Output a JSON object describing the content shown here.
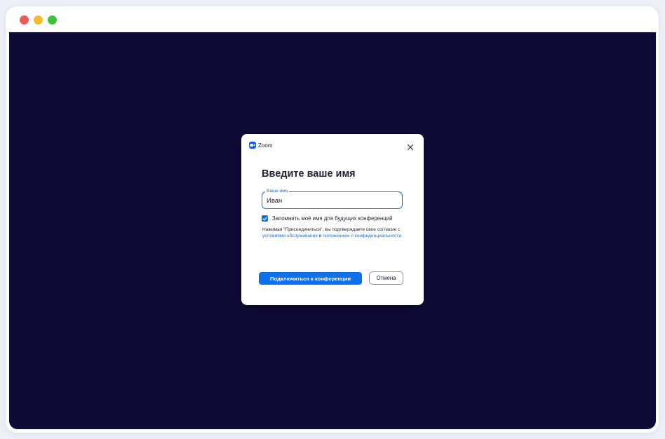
{
  "window": {
    "controls": [
      "close-dot",
      "minimize-dot",
      "maximize-dot"
    ]
  },
  "dialog": {
    "app_name": "Zoom",
    "title": "Введите ваше имя",
    "name_field": {
      "label": "Ваше имя",
      "value": "Иван"
    },
    "remember": {
      "checked": true,
      "label": "Запомнить моё имя для будущих конференций"
    },
    "terms": {
      "prefix": "Нажимая \"Присоединиться\", вы подтверждаете свое согласие с ",
      "terms_link": "условиями обслуживания",
      "middle": " и ",
      "privacy_link": "положением о конфиденциальности",
      "suffix": "."
    },
    "join_button": "Подключиться к конференции",
    "cancel_button": "Отмена"
  },
  "colors": {
    "background": "#0f0b38",
    "accent": "#0e71eb",
    "text": "#232333"
  }
}
